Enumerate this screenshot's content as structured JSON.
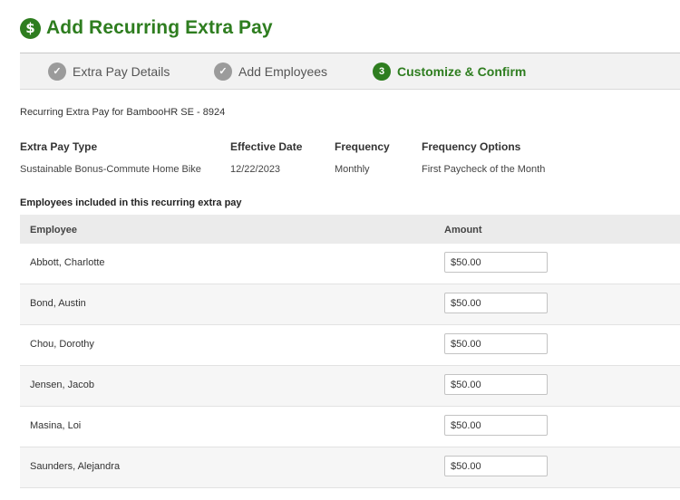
{
  "header": {
    "title": "Add Recurring Extra Pay",
    "icon": "dollar-icon",
    "icon_glyph": "$"
  },
  "stepper": {
    "steps": [
      {
        "label": "Extra Pay Details",
        "status": "done",
        "marker": "✓"
      },
      {
        "label": "Add Employees",
        "status": "done",
        "marker": "✓"
      },
      {
        "label": "Customize & Confirm",
        "status": "active",
        "marker": "3"
      }
    ]
  },
  "subtitle": "Recurring Extra Pay for BambooHR SE - 8924",
  "details": {
    "extra_pay_type": {
      "label": "Extra Pay Type",
      "value": "Sustainable Bonus-Commute Home Bike"
    },
    "effective_date": {
      "label": "Effective Date",
      "value": "12/22/2023"
    },
    "frequency": {
      "label": "Frequency",
      "value": "Monthly"
    },
    "frequency_options": {
      "label": "Frequency Options",
      "value": "First Paycheck of the Month"
    }
  },
  "employees_section": {
    "label": "Employees included in this recurring extra pay",
    "columns": {
      "employee": "Employee",
      "amount": "Amount"
    },
    "rows": [
      {
        "name": "Abbott, Charlotte",
        "amount": "$50.00"
      },
      {
        "name": "Bond, Austin",
        "amount": "$50.00"
      },
      {
        "name": "Chou, Dorothy",
        "amount": "$50.00"
      },
      {
        "name": "Jensen, Jacob",
        "amount": "$50.00"
      },
      {
        "name": "Masina, Loi",
        "amount": "$50.00"
      },
      {
        "name": "Saunders, Alejandra",
        "amount": "$50.00"
      }
    ]
  },
  "colors": {
    "brand_green": "#2e7d1f",
    "done_gray": "#9b9b9b"
  }
}
